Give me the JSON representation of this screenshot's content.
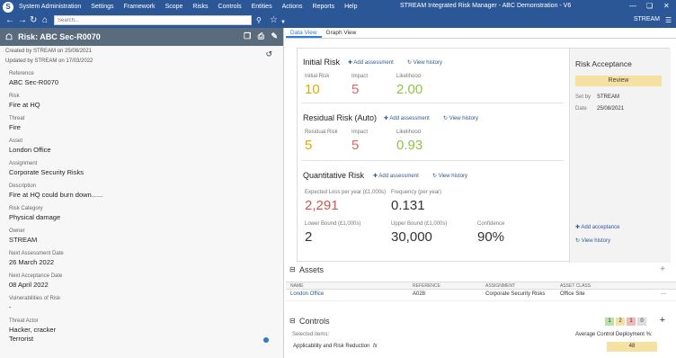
{
  "menu": [
    "System Administration",
    "Settings",
    "Framework",
    "Scope",
    "Risks",
    "Controls",
    "Entities",
    "Actions",
    "Reports",
    "Help"
  ],
  "app_title": "STREAM Integrated Risk Manager - ABC Demonstration - V6",
  "search_placeholder": "Search...",
  "user": "STREAM",
  "risk": {
    "title": "Risk: ABC Sec-R0070",
    "created": "Created by STREAM on 25/08/2021",
    "updated": "Updated by STREAM on 17/03/2022",
    "fields": [
      {
        "label": "Reference",
        "value": "ABC Sec-R0070"
      },
      {
        "label": "Risk",
        "value": "Fire at HQ"
      },
      {
        "label": "Threat",
        "value": "Fire"
      },
      {
        "label": "Asset",
        "value": "London Office"
      },
      {
        "label": "Assignment",
        "value": "Corporate Security Risks"
      },
      {
        "label": "Description",
        "value": "Fire at HQ could burn down......"
      },
      {
        "label": "Risk Category",
        "value": "Physical damage"
      },
      {
        "label": "Owner",
        "value": "STREAM"
      },
      {
        "label": "Next Assessment Date",
        "value": "26 March 2022"
      },
      {
        "label": "Next Acceptance Date",
        "value": "08 April 2022"
      },
      {
        "label": "Vulnerabilities of Risk",
        "value": "-"
      },
      {
        "label": "Threat Actor",
        "value": "Hacker, cracker"
      },
      {
        "label": "",
        "value": "Terrorist"
      }
    ]
  },
  "tabs": [
    "Data View",
    "Graph View"
  ],
  "initial": {
    "title": "Initial Risk",
    "add": "Add assessment",
    "hist": "View history",
    "risk_label": "Initial Risk",
    "risk": "10",
    "impact_label": "Impact",
    "impact": "5",
    "lik_label": "Likelihood",
    "lik": "2.00"
  },
  "residual": {
    "title": "Residual Risk (Auto)",
    "add": "Add assessment",
    "hist": "View history",
    "risk_label": "Residual Risk",
    "risk": "5",
    "impact_label": "Impact",
    "impact": "5",
    "lik_label": "Likelihood",
    "lik": "0.93"
  },
  "quant": {
    "title": "Quantitative Risk",
    "add": "Add assessment",
    "hist": "View history",
    "el_label": "Expected Loss per year (£1,000s)",
    "el": "2,291",
    "freq_label": "Frequency (per year)",
    "freq": "0.131",
    "lb_label": "Lower Bound (£1,000s)",
    "lb": "2",
    "ub_label": "Upper Bound (£1,000s)",
    "ub": "30,000",
    "conf_label": "Confidence",
    "conf": "90%"
  },
  "acceptance": {
    "title": "Risk Acceptance",
    "review": "Review",
    "setby_label": "Set by",
    "setby": "STREAM",
    "date_label": "Date",
    "date": "25/08/2021",
    "add": "Add acceptance",
    "hist": "View history"
  },
  "assets": {
    "title": "Assets",
    "headers": [
      "NAME",
      "REFERENCE",
      "ASSIGNMENT",
      "ASSET CLASS"
    ],
    "row": [
      "London Office",
      "A028",
      "Corporate Security Risks",
      "Office Site"
    ]
  },
  "controls": {
    "title": "Controls",
    "selected": "Selected items:",
    "badges": [
      "1",
      "2",
      "1",
      "0"
    ],
    "avg_label": "Average Control Deployment %:",
    "avg": "48",
    "applicability": "Applicability and Risk Reduction"
  },
  "colors": {
    "header": "#2b5797",
    "risk_amber": "#e0a800",
    "impact_red": "#e06666",
    "lik_green": "#8cc63f",
    "loss_red": "#d9534f"
  }
}
